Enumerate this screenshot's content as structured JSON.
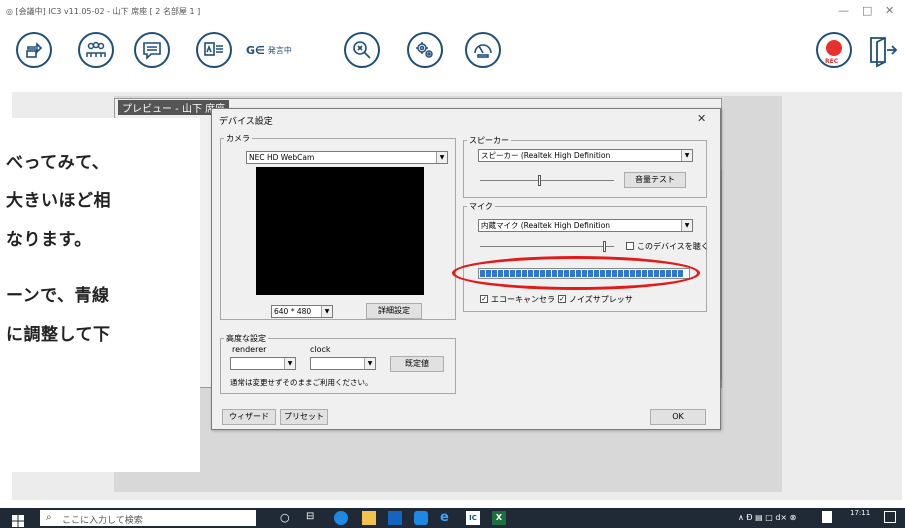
{
  "app": {
    "title": "◎ [会議中] IC3 v11.05-02 - 山下  席座 [ 2 名部屋 1 ]",
    "minimize": "—",
    "maximize": "□",
    "close": "✕",
    "speaking_label": "発言中",
    "speaking_prefix": "G∈",
    "rec_label": "REC"
  },
  "behind_window_title": "プレビュー - 山下 席座",
  "overlay": {
    "lines": [
      "べってみて、",
      "大きいほど相",
      "なります。",
      "ーンで、青線",
      "に調整して下"
    ]
  },
  "dialog": {
    "title": "デバイス設定",
    "close": "✕",
    "camera": {
      "label": "カメラ",
      "device": "NEC HD WebCam",
      "resolution": "640 * 480",
      "detail_button": "詳細設定"
    },
    "advanced": {
      "label": "高度な設定",
      "renderer_label": "renderer",
      "clock_label": "clock",
      "default_button": "既定値",
      "note": "通常は変更せずそのままご利用ください。"
    },
    "speaker": {
      "label": "スピーカー",
      "device": "スピーカー (Realtek High Definition",
      "volume_position": 0.45,
      "test_button": "音量テスト"
    },
    "mic": {
      "label": "マイク",
      "device": "内蔵マイク (Realtek High Definition",
      "volume_position": 0.93,
      "listen_label": "このデバイスを聴く",
      "listen_checked": false,
      "meter_level": 0.98,
      "echo_cancel_label": "エコーキャンセラ",
      "echo_cancel_checked": true,
      "noise_suppress_label": "ノイズサプレッサ",
      "noise_suppress_checked": true
    },
    "wizard_button": "ウィザード",
    "preset_button": "プリセット",
    "ok_button": "OK"
  },
  "taskbar": {
    "search_placeholder": "ここに入力して検索",
    "time": "17:11",
    "tray": "∧ Đ ▤ □ d× ⊗"
  },
  "colors": {
    "toolbar_icon": "#1e4f7c",
    "rec": "#e8312f",
    "highlight_ellipse": "#e21a1a",
    "meter_fill": "#2f77d0"
  }
}
